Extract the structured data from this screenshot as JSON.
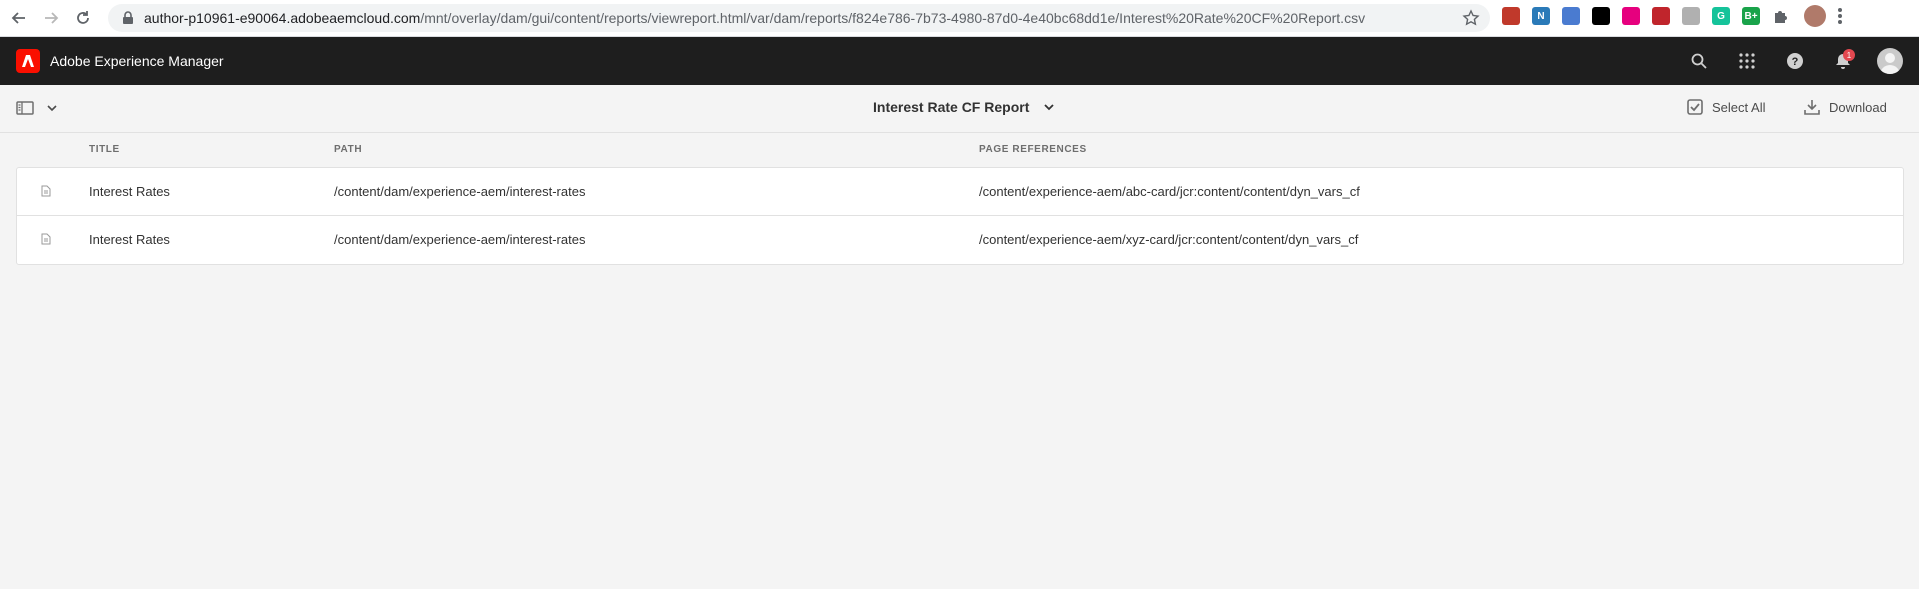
{
  "browser": {
    "url_host": "author-p10961-e90064.adobeaemcloud.com",
    "url_path": "/mnt/overlay/dam/gui/content/reports/viewreport.html/var/dam/reports/f824e786-7b73-4980-87d0-4e40bc68dd1e/Interest%20Rate%20CF%20Report.csv",
    "extensions": [
      {
        "name": "pen-extension-icon",
        "color": "#c0392b",
        "label": ""
      },
      {
        "name": "n-extension-icon",
        "color": "#2a7ab8",
        "label": "N"
      },
      {
        "name": "circle-extension-icon",
        "color": "#4a7bd0",
        "label": ""
      },
      {
        "name": "spy-extension-icon",
        "color": "#000000",
        "label": ""
      },
      {
        "name": "eye-extension-icon",
        "color": "#e6007e",
        "label": ""
      },
      {
        "name": "red-square-extension-icon",
        "color": "#c0252c",
        "label": ""
      },
      {
        "name": "feather-extension-icon",
        "color": "#b0b0b0",
        "label": ""
      },
      {
        "name": "grammarly-extension-icon",
        "color": "#15c39a",
        "label": "G"
      },
      {
        "name": "b-plus-extension-icon",
        "color": "#19a34a",
        "label": "B+"
      }
    ]
  },
  "shell": {
    "product_name": "Adobe Experience Manager",
    "notification_count": "1",
    "accent": "#fa0f00"
  },
  "actionbar": {
    "report_title": "Interest Rate CF Report",
    "select_all_label": "Select All",
    "download_label": "Download"
  },
  "table": {
    "headers": {
      "title": "Title",
      "path": "Path",
      "page_references": "Page References"
    },
    "rows": [
      {
        "title": "Interest Rates",
        "path": "/content/dam/experience-aem/interest-rates",
        "page_references": "/content/experience-aem/abc-card/jcr:content/content/dyn_vars_cf"
      },
      {
        "title": "Interest Rates",
        "path": "/content/dam/experience-aem/interest-rates",
        "page_references": "/content/experience-aem/xyz-card/jcr:content/content/dyn_vars_cf"
      }
    ]
  }
}
